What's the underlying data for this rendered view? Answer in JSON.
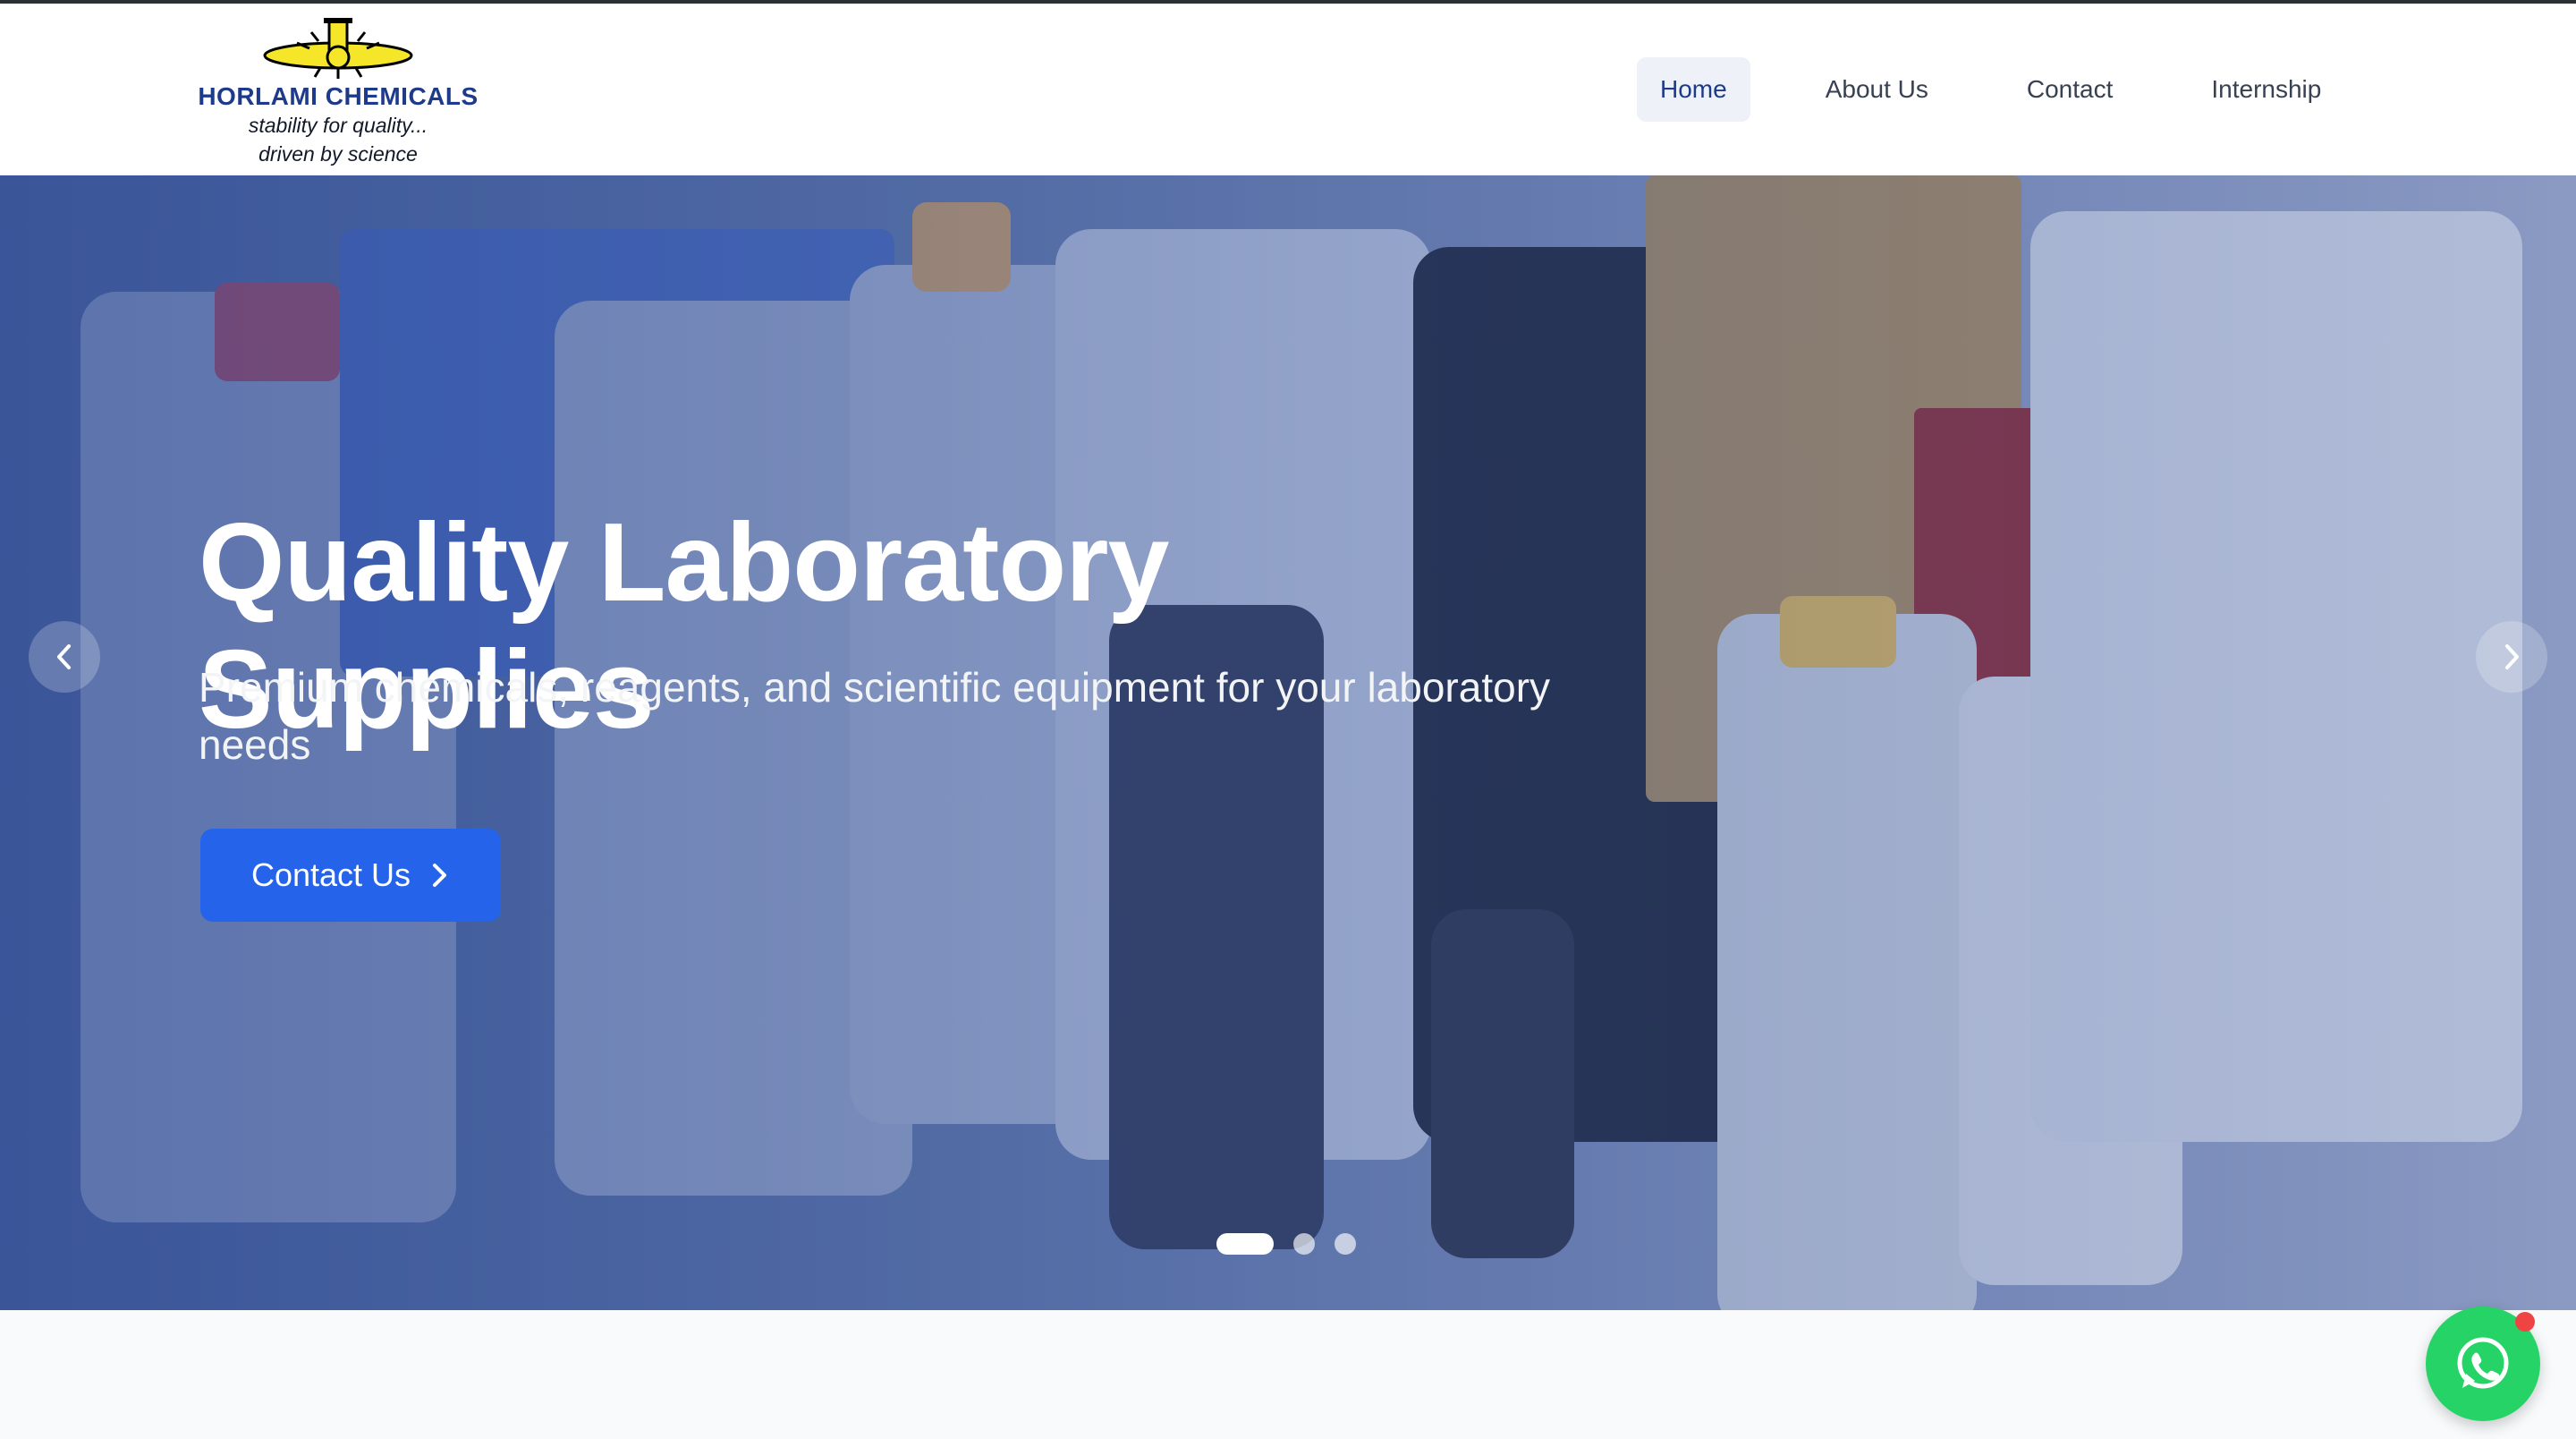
{
  "brand": {
    "name": "HORLAMI CHEMICALS",
    "tagline_1": "stability for quality...",
    "tagline_2": "driven by science"
  },
  "nav": {
    "items": [
      {
        "label": "Home",
        "active": true
      },
      {
        "label": "About Us",
        "active": false
      },
      {
        "label": "Contact",
        "active": false
      },
      {
        "label": "Internship",
        "active": false
      }
    ]
  },
  "hero": {
    "title": "Quality Laboratory Supplies",
    "subtitle": "Premium chemicals, reagents, and scientific equipment for your laboratory needs",
    "cta_label": "Contact Us",
    "slides_total": 3,
    "active_slide": 1
  },
  "colors": {
    "brand_blue": "#1e3a8a",
    "cta_blue": "#2563eb",
    "whatsapp_green": "#25d366",
    "badge_red": "#ef4444"
  },
  "icons": {
    "prev": "chevron-left-icon",
    "next": "chevron-right-icon",
    "cta": "chevron-right-icon",
    "chat": "whatsapp-icon"
  }
}
